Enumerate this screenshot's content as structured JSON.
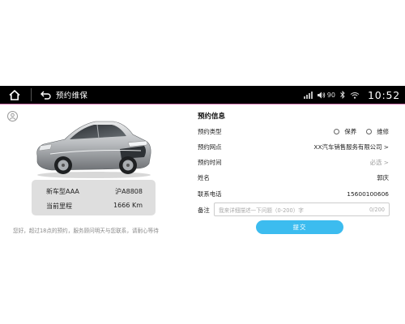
{
  "header": {
    "title": "预约维保",
    "status": {
      "volume_level": "90",
      "clock": "10:52"
    }
  },
  "vehicle": {
    "model": "新车型AAA",
    "plate": "沪A8808",
    "mileage_label": "当前里程",
    "mileage_value": "1666 Km"
  },
  "notice": "您好，超过18点的预约，服务顾问明天与您联系，请耐心等待",
  "form": {
    "section_title": "预约信息",
    "type": {
      "label": "预约类型",
      "options": [
        "保养",
        "维修"
      ]
    },
    "dealer": {
      "label": "预约网点",
      "value": "XX汽车销售服务有限公司 >"
    },
    "time": {
      "label": "预约时间",
      "placeholder": "必选 >"
    },
    "name": {
      "label": "姓名",
      "value": "郭庆"
    },
    "phone": {
      "label": "联系电话",
      "value": "15600100606"
    },
    "remark": {
      "label": "备注",
      "placeholder": "我来详细描述一下问题（0-200）字",
      "counter": "0/200"
    },
    "submit_label": "提交"
  },
  "colors": {
    "accent": "#3cbcef",
    "topbar": "#000000",
    "card_bg": "#dedede"
  }
}
